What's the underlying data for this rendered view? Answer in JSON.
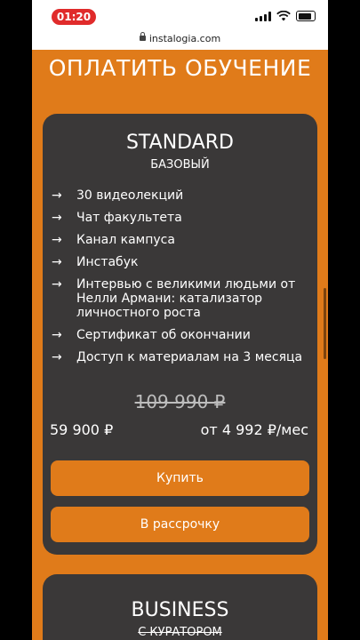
{
  "status": {
    "time": "01:20"
  },
  "browser": {
    "url": "instalogia.com"
  },
  "page": {
    "heading": "ОПЛАТИТЬ ОБУЧЕНИЕ"
  },
  "standard": {
    "name": "STANDARD",
    "subtitle": "БАЗОВЫЙ",
    "features": [
      "30 видеолекций",
      "Чат факультета",
      "Канал кампуса",
      "Инстабук",
      "Интервью с великими людьми от Нелли Армани: катализатор личностного роста",
      "Сертификат об окончании",
      "Доступ к материалам на 3 месяца"
    ],
    "old_price": "109 990 ₽",
    "price": "59 900 ₽",
    "installment_price": "от 4 992 ₽/мес",
    "buy_label": "Купить",
    "installment_label": "В рассрочку"
  },
  "business": {
    "name": "BUSINESS",
    "subtitle": "С КУРАТОРОМ"
  },
  "icons": {
    "feature_bullet": "arrow-right-icon",
    "arrow_glyph": "→"
  },
  "colors": {
    "accent": "#e07b1a",
    "card": "#3a3838",
    "time_pill": "#e02b2b"
  }
}
